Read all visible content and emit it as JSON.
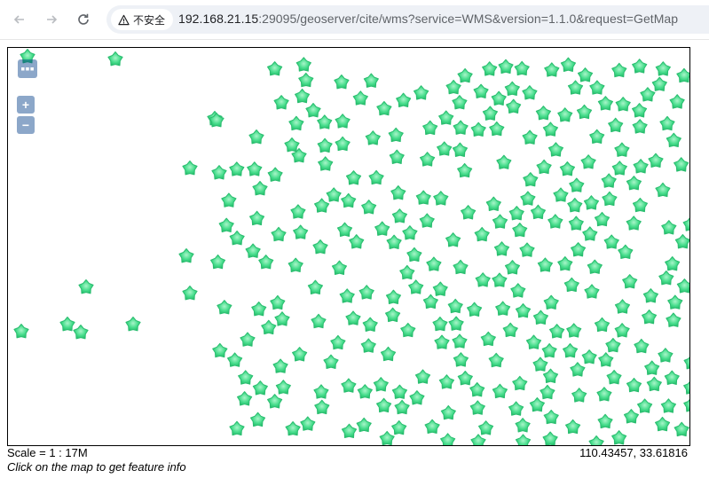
{
  "browser": {
    "security_label": "不安全",
    "url_host": "192.168.21.15",
    "url_rest": ":29095/geoserver/cite/wms?service=WMS&version=1.1.0&request=GetMap"
  },
  "map": {
    "zoom_in": "+",
    "zoom_out": "−",
    "marker_color": "#3ddc84",
    "marker_count": "approximately 300 star-shaped point markers"
  },
  "footer": {
    "scale": "Scale = 1 : 17M",
    "coords": "110.43457, 33.61816",
    "hint": "Click on the map to get feature info"
  }
}
